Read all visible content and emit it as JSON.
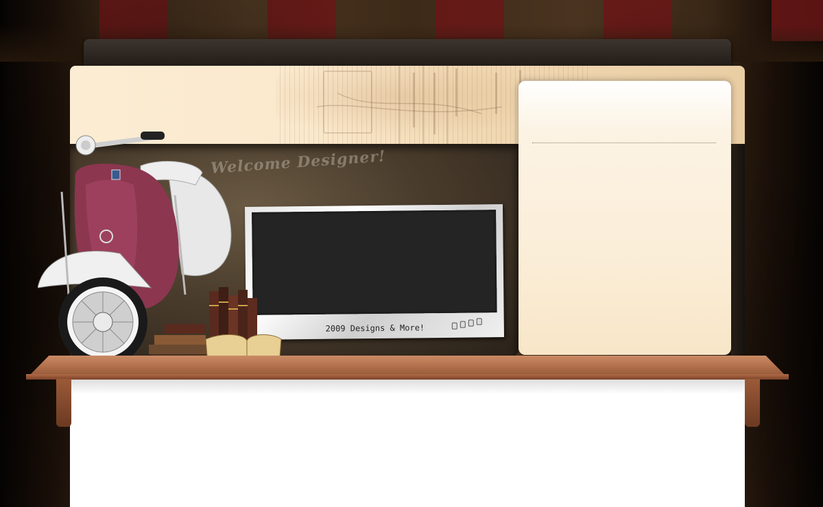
{
  "header": {
    "welcome_text": "Welcome Designer!"
  },
  "photo": {
    "caption": "2009 Designs & More!"
  },
  "colors": {
    "cream": "#fbecd3",
    "dark_band": "#4a3c2c",
    "shelf_wood": "#b6744f",
    "stripe_red": "#6a1616",
    "scooter_body": "#8c3650"
  }
}
